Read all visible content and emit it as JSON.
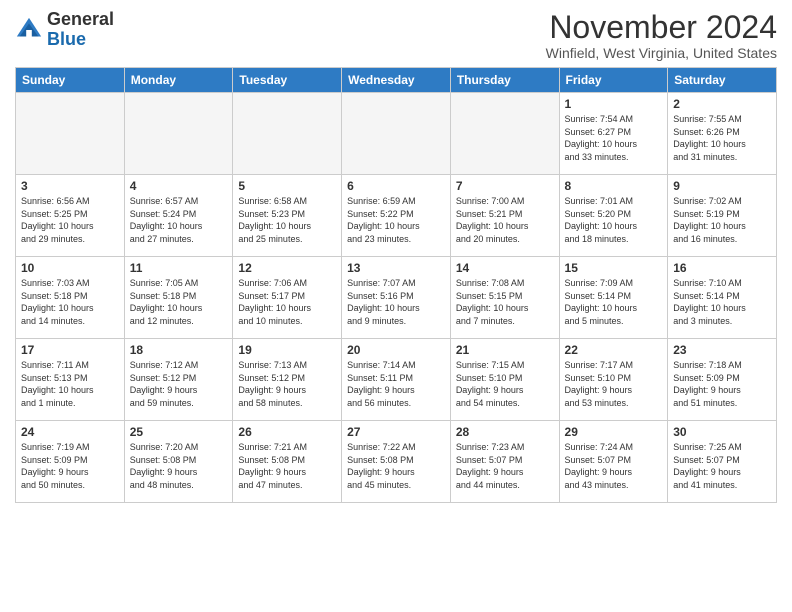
{
  "header": {
    "logo_general": "General",
    "logo_blue": "Blue",
    "month": "November 2024",
    "location": "Winfield, West Virginia, United States"
  },
  "weekdays": [
    "Sunday",
    "Monday",
    "Tuesday",
    "Wednesday",
    "Thursday",
    "Friday",
    "Saturday"
  ],
  "weeks": [
    [
      {
        "day": "",
        "info": ""
      },
      {
        "day": "",
        "info": ""
      },
      {
        "day": "",
        "info": ""
      },
      {
        "day": "",
        "info": ""
      },
      {
        "day": "",
        "info": ""
      },
      {
        "day": "1",
        "info": "Sunrise: 7:54 AM\nSunset: 6:27 PM\nDaylight: 10 hours\nand 33 minutes."
      },
      {
        "day": "2",
        "info": "Sunrise: 7:55 AM\nSunset: 6:26 PM\nDaylight: 10 hours\nand 31 minutes."
      }
    ],
    [
      {
        "day": "3",
        "info": "Sunrise: 6:56 AM\nSunset: 5:25 PM\nDaylight: 10 hours\nand 29 minutes."
      },
      {
        "day": "4",
        "info": "Sunrise: 6:57 AM\nSunset: 5:24 PM\nDaylight: 10 hours\nand 27 minutes."
      },
      {
        "day": "5",
        "info": "Sunrise: 6:58 AM\nSunset: 5:23 PM\nDaylight: 10 hours\nand 25 minutes."
      },
      {
        "day": "6",
        "info": "Sunrise: 6:59 AM\nSunset: 5:22 PM\nDaylight: 10 hours\nand 23 minutes."
      },
      {
        "day": "7",
        "info": "Sunrise: 7:00 AM\nSunset: 5:21 PM\nDaylight: 10 hours\nand 20 minutes."
      },
      {
        "day": "8",
        "info": "Sunrise: 7:01 AM\nSunset: 5:20 PM\nDaylight: 10 hours\nand 18 minutes."
      },
      {
        "day": "9",
        "info": "Sunrise: 7:02 AM\nSunset: 5:19 PM\nDaylight: 10 hours\nand 16 minutes."
      }
    ],
    [
      {
        "day": "10",
        "info": "Sunrise: 7:03 AM\nSunset: 5:18 PM\nDaylight: 10 hours\nand 14 minutes."
      },
      {
        "day": "11",
        "info": "Sunrise: 7:05 AM\nSunset: 5:18 PM\nDaylight: 10 hours\nand 12 minutes."
      },
      {
        "day": "12",
        "info": "Sunrise: 7:06 AM\nSunset: 5:17 PM\nDaylight: 10 hours\nand 10 minutes."
      },
      {
        "day": "13",
        "info": "Sunrise: 7:07 AM\nSunset: 5:16 PM\nDaylight: 10 hours\nand 9 minutes."
      },
      {
        "day": "14",
        "info": "Sunrise: 7:08 AM\nSunset: 5:15 PM\nDaylight: 10 hours\nand 7 minutes."
      },
      {
        "day": "15",
        "info": "Sunrise: 7:09 AM\nSunset: 5:14 PM\nDaylight: 10 hours\nand 5 minutes."
      },
      {
        "day": "16",
        "info": "Sunrise: 7:10 AM\nSunset: 5:14 PM\nDaylight: 10 hours\nand 3 minutes."
      }
    ],
    [
      {
        "day": "17",
        "info": "Sunrise: 7:11 AM\nSunset: 5:13 PM\nDaylight: 10 hours\nand 1 minute."
      },
      {
        "day": "18",
        "info": "Sunrise: 7:12 AM\nSunset: 5:12 PM\nDaylight: 9 hours\nand 59 minutes."
      },
      {
        "day": "19",
        "info": "Sunrise: 7:13 AM\nSunset: 5:12 PM\nDaylight: 9 hours\nand 58 minutes."
      },
      {
        "day": "20",
        "info": "Sunrise: 7:14 AM\nSunset: 5:11 PM\nDaylight: 9 hours\nand 56 minutes."
      },
      {
        "day": "21",
        "info": "Sunrise: 7:15 AM\nSunset: 5:10 PM\nDaylight: 9 hours\nand 54 minutes."
      },
      {
        "day": "22",
        "info": "Sunrise: 7:17 AM\nSunset: 5:10 PM\nDaylight: 9 hours\nand 53 minutes."
      },
      {
        "day": "23",
        "info": "Sunrise: 7:18 AM\nSunset: 5:09 PM\nDaylight: 9 hours\nand 51 minutes."
      }
    ],
    [
      {
        "day": "24",
        "info": "Sunrise: 7:19 AM\nSunset: 5:09 PM\nDaylight: 9 hours\nand 50 minutes."
      },
      {
        "day": "25",
        "info": "Sunrise: 7:20 AM\nSunset: 5:08 PM\nDaylight: 9 hours\nand 48 minutes."
      },
      {
        "day": "26",
        "info": "Sunrise: 7:21 AM\nSunset: 5:08 PM\nDaylight: 9 hours\nand 47 minutes."
      },
      {
        "day": "27",
        "info": "Sunrise: 7:22 AM\nSunset: 5:08 PM\nDaylight: 9 hours\nand 45 minutes."
      },
      {
        "day": "28",
        "info": "Sunrise: 7:23 AM\nSunset: 5:07 PM\nDaylight: 9 hours\nand 44 minutes."
      },
      {
        "day": "29",
        "info": "Sunrise: 7:24 AM\nSunset: 5:07 PM\nDaylight: 9 hours\nand 43 minutes."
      },
      {
        "day": "30",
        "info": "Sunrise: 7:25 AM\nSunset: 5:07 PM\nDaylight: 9 hours\nand 41 minutes."
      }
    ]
  ]
}
